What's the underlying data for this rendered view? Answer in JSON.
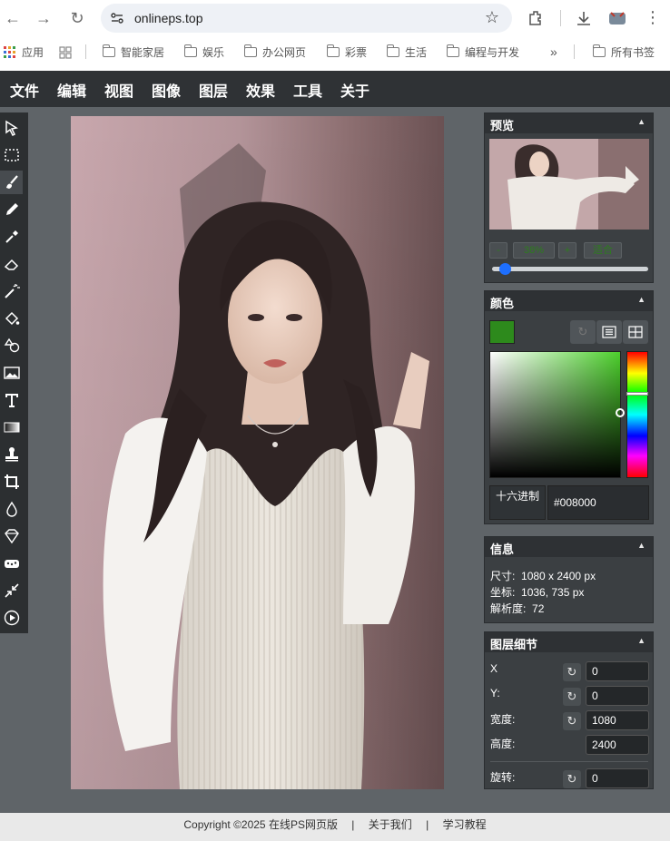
{
  "browser": {
    "url": "onlineps.top",
    "bookmarks": [
      "应用",
      "智能家居",
      "娱乐",
      "办公网页",
      "彩票",
      "生活",
      "编程与开发"
    ],
    "all_bookmarks": "所有书签",
    "overflow": "»"
  },
  "menu": [
    "文件",
    "编辑",
    "视图",
    "图像",
    "图层",
    "效果",
    "工具",
    "关于"
  ],
  "tools": [
    "select-arrow-icon",
    "rect-select-icon",
    "brush-icon",
    "pencil-icon",
    "eyedropper-icon",
    "eraser-icon",
    "magic-wand-icon",
    "fill-bucket-icon",
    "shapes-icon",
    "image-icon",
    "text-icon",
    "gradient-icon",
    "stamp-icon",
    "crop-icon",
    "blur-drop-icon",
    "sharpen-icon",
    "sponge-icon",
    "resize-icon",
    "play-icon"
  ],
  "preview": {
    "title": "预览",
    "zoom_minus": "-",
    "zoom_value": "38%",
    "zoom_plus": "+",
    "fit": "适合",
    "zoom_slider": 0.05
  },
  "color": {
    "title": "颜色",
    "current": "#2d8a1c",
    "hex_label": "十六进制",
    "hex_value": "#008000"
  },
  "info": {
    "title": "信息",
    "size_label": "尺寸:",
    "size_value": "1080 x 2400 px",
    "coord_label": "坐标:",
    "coord_value": "1036, 735 px",
    "res_label": "解析度:",
    "res_value": "72"
  },
  "layer": {
    "title": "图层细节",
    "x_label": "X",
    "x_value": "0",
    "y_label": "Y:",
    "y_value": "0",
    "w_label": "宽度:",
    "w_value": "1080",
    "h_label": "高度:",
    "h_value": "2400",
    "rot_label": "旋转:",
    "rot_value": "0"
  },
  "footer": {
    "copyright": "Copyright ©2025 在线PS网页版",
    "sep": "|",
    "about": "关于我们",
    "tutorial": "学习教程"
  }
}
